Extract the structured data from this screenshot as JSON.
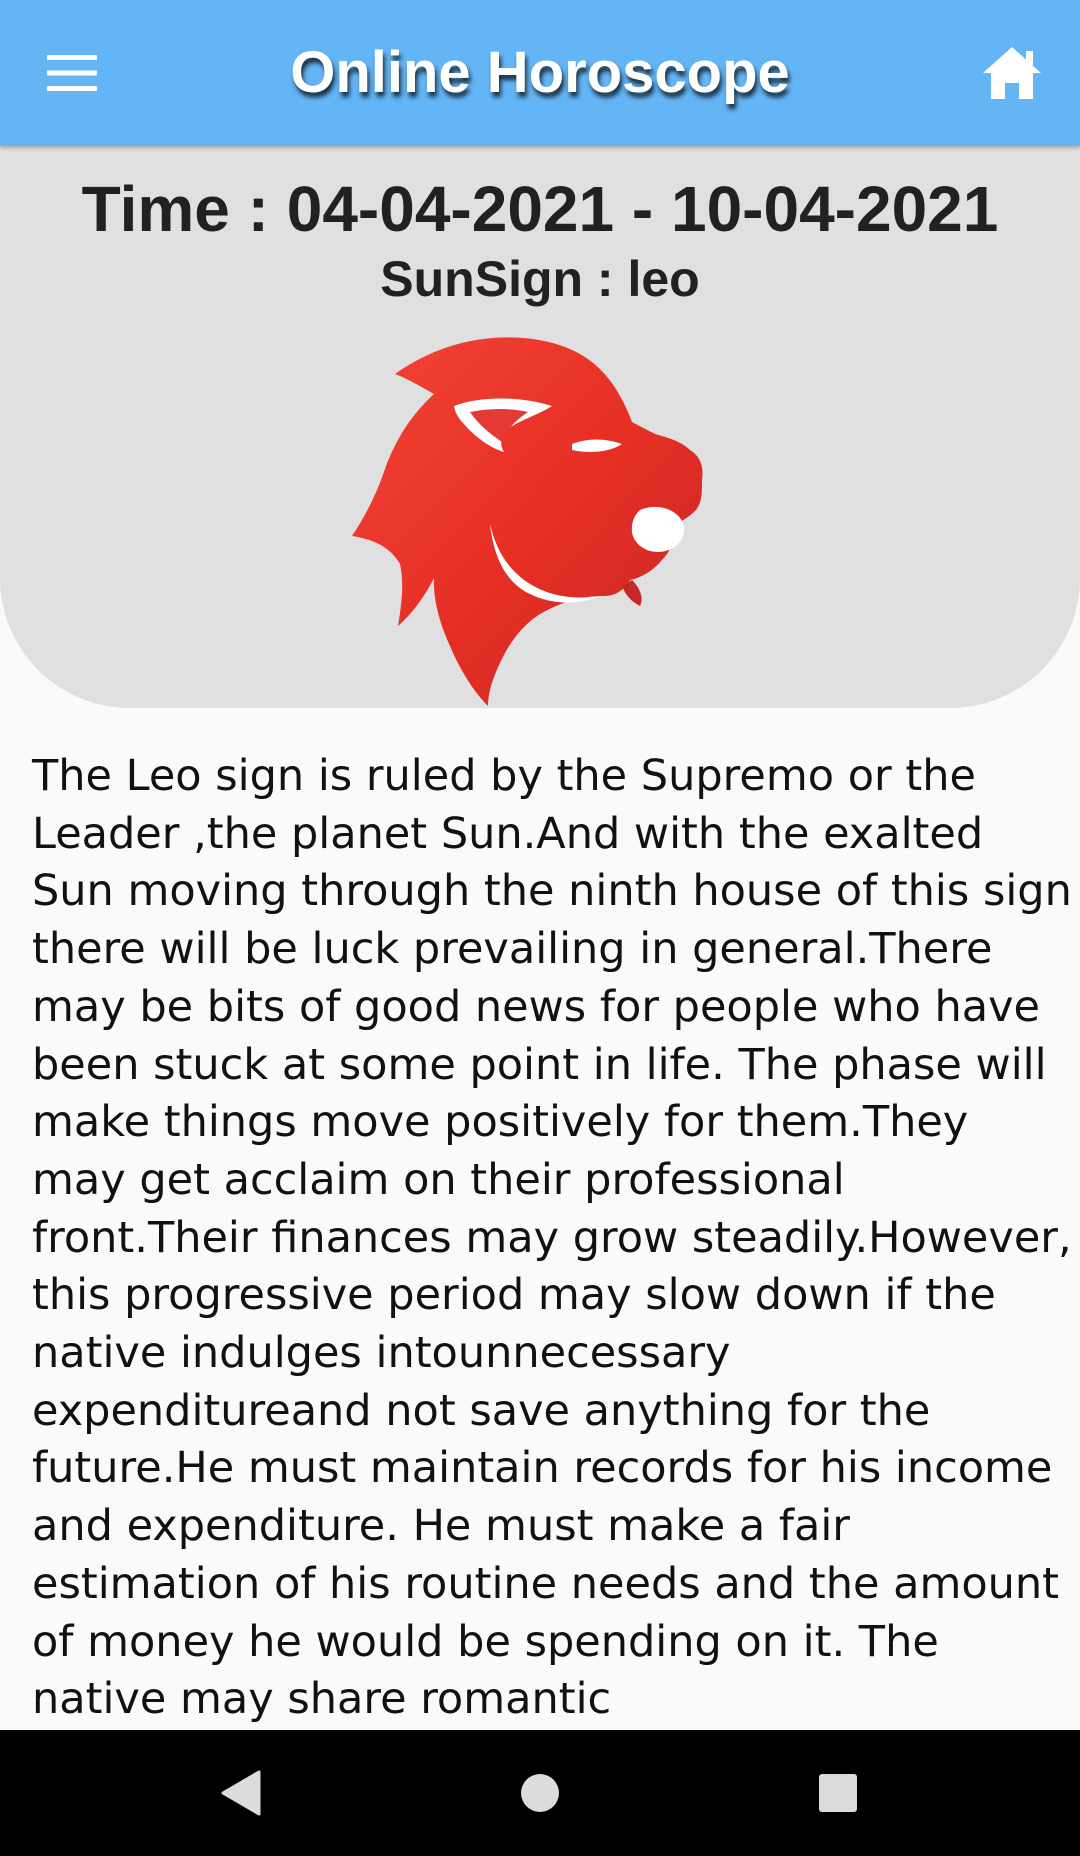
{
  "appbar": {
    "title": "Online Horoscope",
    "menu_icon": "hamburger-menu-icon",
    "home_icon": "home-icon",
    "background_color": "#64b5f6"
  },
  "header": {
    "time_text": "Time : 04-04-2021 - 10-04-2021",
    "sunsign_text": "SunSign : leo",
    "sign_icon": "leo-lion-icon",
    "sign_icon_color": "#e53935",
    "card_color": "#e0e0e0"
  },
  "content": {
    "horoscope_text": "The Leo sign is ruled by the Supremo or the Leader ,the planet Sun.And with the exalted Sun moving through the ninth house of this sign there will be luck prevailing in general.There may be bits of good news for people who have been stuck at some point in life. The phase will make things move positively for them.They may get acclaim on their professional front.Their finances may grow steadily.However, this progressive period may slow down if the native indulges intounnecessary expenditureand not save anything for the future.He must maintain records for his income and expenditure. He must make a fair estimation of his routine needs and the amount of money he would be spending on it. The native may share romantic"
  },
  "navbar": {
    "back_icon": "back-triangle-icon",
    "home_icon": "home-circle-icon",
    "recents_icon": "recents-square-icon"
  }
}
